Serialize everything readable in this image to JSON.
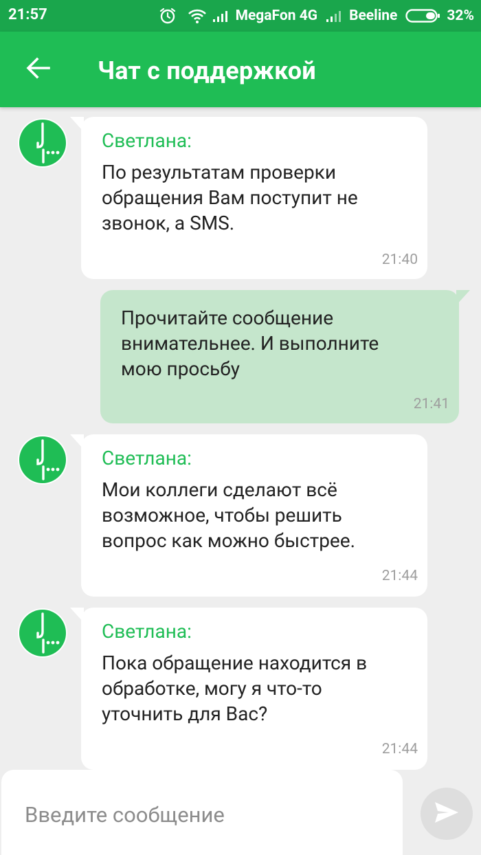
{
  "status_bar": {
    "time": "21:57",
    "carrier_1": "MegaFon 4G",
    "carrier_2": "Beeline",
    "battery": "32%",
    "icons": [
      "alarm-icon",
      "wifi-icon",
      "signal-icon",
      "signal-icon",
      "battery-icon"
    ]
  },
  "header": {
    "back_icon": "arrow-left-icon",
    "title": "Чат с поддержкой"
  },
  "messages": [
    {
      "direction": "incoming",
      "sender": "Светлана:",
      "text": "По результатам проверки\nобращения Вам поступит не\nзвонок, а SMS.",
      "time": "21:40"
    },
    {
      "direction": "outgoing",
      "text": "Прочитайте сообщение\nвнимательнее. И выполните\nмою просьбу",
      "time": "21:41"
    },
    {
      "direction": "incoming",
      "sender": "Светлана:",
      "text": "Мои коллеги сделают всё\nвозможное, чтобы решить\nвопрос как можно быстрее.",
      "time": "21:44"
    },
    {
      "direction": "incoming",
      "sender": "Светлана:",
      "text": "Пока обращение находится в\nобработке, могу я что-то\nуточнить для Вас?",
      "time": "21:44"
    }
  ],
  "composer": {
    "placeholder": "Введите сообщение",
    "value": "",
    "send_icon": "send-icon"
  },
  "colors": {
    "status_bar": "#1aa64c",
    "app_bar": "#1fbd55",
    "sender_name": "#1fbd55",
    "outgoing_bubble": "#c5e6cc",
    "chat_background": "#eeeeee"
  }
}
